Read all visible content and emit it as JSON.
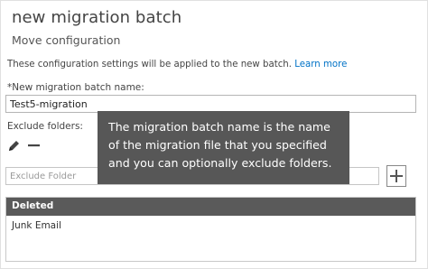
{
  "dialog": {
    "title": "new migration batch",
    "subtitle": "Move configuration",
    "info_text": "These configuration settings will be applied to the new batch.",
    "learn_more": "Learn more"
  },
  "batch_name": {
    "label": "*New migration batch name:",
    "value": "Test5-migration"
  },
  "exclude": {
    "label": "Exclude folders:",
    "placeholder": "Exclude Folder",
    "edit_icon": "pencil-icon",
    "remove_icon": "minus-icon",
    "add_icon": "plus-icon"
  },
  "folders": {
    "header": "Deleted",
    "items": [
      "Junk Email"
    ]
  },
  "tooltip": {
    "lines": [
      "The migration batch name is the name",
      "of the migration file that you specified",
      "and you can optionally exclude folders."
    ]
  }
}
